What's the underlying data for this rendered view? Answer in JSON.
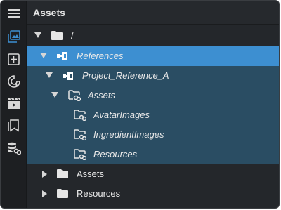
{
  "panel": {
    "title": "Assets"
  },
  "sidebar": {
    "items": [
      {
        "icon": "hamburger-menu-icon"
      },
      {
        "icon": "image-gallery-icon",
        "active": true
      },
      {
        "icon": "add-square-icon"
      },
      {
        "icon": "palette-icon"
      },
      {
        "icon": "clapperboard-icon"
      },
      {
        "icon": "bookmark-stack-icon"
      },
      {
        "icon": "database-link-icon"
      }
    ]
  },
  "tree": {
    "rows": [
      {
        "label": "/",
        "icon": "folder-icon",
        "expanded": true,
        "italic": false
      },
      {
        "label": "References",
        "icon": "references-icon",
        "expanded": true,
        "italic": true,
        "selected": "primary"
      },
      {
        "label": "Project_Reference_A",
        "icon": "project-reference-icon",
        "expanded": true,
        "italic": true,
        "selected": "secondary"
      },
      {
        "label": "Assets",
        "icon": "linked-folder-icon",
        "expanded": true,
        "italic": true,
        "selected": "secondary"
      },
      {
        "label": "AvatarImages",
        "icon": "linked-folder-icon",
        "italic": true,
        "selected": "secondary"
      },
      {
        "label": "IngredientImages",
        "icon": "linked-folder-icon",
        "italic": true,
        "selected": "secondary"
      },
      {
        "label": "Resources",
        "icon": "linked-folder-icon",
        "italic": true,
        "selected": "secondary"
      },
      {
        "label": "Assets",
        "icon": "folder-icon",
        "expanded": false,
        "italic": false
      },
      {
        "label": "Resources",
        "icon": "folder-icon",
        "expanded": false,
        "italic": false
      }
    ]
  },
  "colors": {
    "selection_primary": "#3d8fd1",
    "selection_secondary": "#2a4d63",
    "accent": "#3d8fd1"
  }
}
